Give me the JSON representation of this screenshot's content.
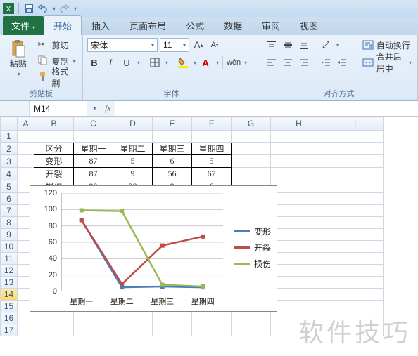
{
  "qat": {
    "save_title": "保存"
  },
  "tabs": {
    "file": "文件",
    "home": "开始",
    "insert": "插入",
    "layout": "页面布局",
    "formulas": "公式",
    "data": "数据",
    "review": "审阅",
    "view": "视图"
  },
  "ribbon": {
    "clipboard": {
      "label": "剪贴板",
      "paste": "粘贴",
      "cut": "剪切",
      "copy": "复制",
      "format": "格式刷"
    },
    "font": {
      "label": "字体",
      "name": "宋体",
      "size": "11"
    },
    "align": {
      "label": "对齐方式",
      "wrap": "自动换行",
      "merge": "合并后居中"
    }
  },
  "namebox": "M14",
  "cols": [
    "A",
    "B",
    "C",
    "D",
    "E",
    "F",
    "G",
    "H",
    "I"
  ],
  "rownums": [
    1,
    2,
    3,
    4,
    5,
    6,
    7,
    8,
    9,
    10,
    11,
    12,
    13,
    14,
    15,
    16,
    17
  ],
  "table": {
    "header": [
      "区分",
      "星期一",
      "星期二",
      "星期三",
      "星期四"
    ],
    "rows": [
      {
        "label": "变形",
        "vals": [
          87,
          5,
          6,
          5
        ]
      },
      {
        "label": "开裂",
        "vals": [
          87,
          9,
          56,
          67
        ]
      },
      {
        "label": "损伤",
        "vals": [
          99,
          98,
          8,
          6
        ]
      }
    ]
  },
  "chart_data": {
    "type": "line",
    "categories": [
      "星期一",
      "星期二",
      "星期三",
      "星期四"
    ],
    "series": [
      {
        "name": "变形",
        "color": "#4a7ebb",
        "values": [
          87,
          5,
          6,
          5
        ]
      },
      {
        "name": "开裂",
        "color": "#be4b48",
        "values": [
          87,
          9,
          56,
          67
        ]
      },
      {
        "name": "损伤",
        "color": "#98b954",
        "values": [
          99,
          98,
          8,
          6
        ]
      }
    ],
    "ylim": [
      0,
      120
    ],
    "yticks": [
      0,
      20,
      40,
      60,
      80,
      100,
      120
    ]
  },
  "watermark": "软件技巧"
}
